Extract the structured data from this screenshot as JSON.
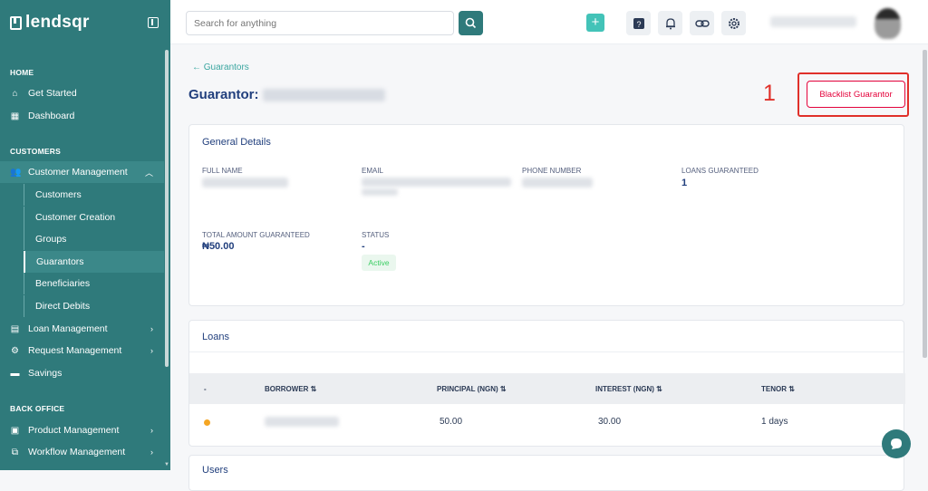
{
  "brand": {
    "name": "lendsqr"
  },
  "sidebar": {
    "sections": {
      "home": "HOME",
      "customers": "CUSTOMERS",
      "back_office": "BACK OFFICE"
    },
    "items": {
      "get_started": "Get Started",
      "dashboard": "Dashboard",
      "customer_management": "Customer Management",
      "customers": "Customers",
      "customer_creation": "Customer Creation",
      "groups": "Groups",
      "guarantors": "Guarantors",
      "beneficiaries": "Beneficiaries",
      "direct_debits": "Direct Debits",
      "loan_management": "Loan Management",
      "request_management": "Request Management",
      "savings": "Savings",
      "product_management": "Product Management",
      "workflow_management": "Workflow Management"
    }
  },
  "search": {
    "placeholder": "Search for anything"
  },
  "page": {
    "back_label": "Guarantors",
    "title_prefix": "Guarantor:",
    "annotation_number": "1",
    "blacklist_button": "Blacklist Guarantor"
  },
  "general": {
    "title": "General Details",
    "full_name_label": "Full Name",
    "email_label": "Email",
    "phone_label": "Phone Number",
    "loans_guaranteed_label": "Loans Guaranteed",
    "loans_guaranteed_value": "1",
    "total_amount_label": "Total Amount Guaranteed",
    "total_amount_value": "₦50.00",
    "status_label": "Status",
    "status_value": "-",
    "status_badge": "Active"
  },
  "loans": {
    "title": "Loans",
    "headers": [
      "-",
      "Borrower",
      "Principal (NGN)",
      "Interest (NGN)",
      "Tenor"
    ],
    "row": {
      "principal": "50.00",
      "interest": "30.00",
      "tenor": "1 days"
    }
  },
  "users": {
    "title": "Users"
  },
  "colors": {
    "sidebar": "#2f7a7b",
    "accent": "#43c3b8",
    "danger": "#e4033b",
    "title": "#213f7d"
  }
}
